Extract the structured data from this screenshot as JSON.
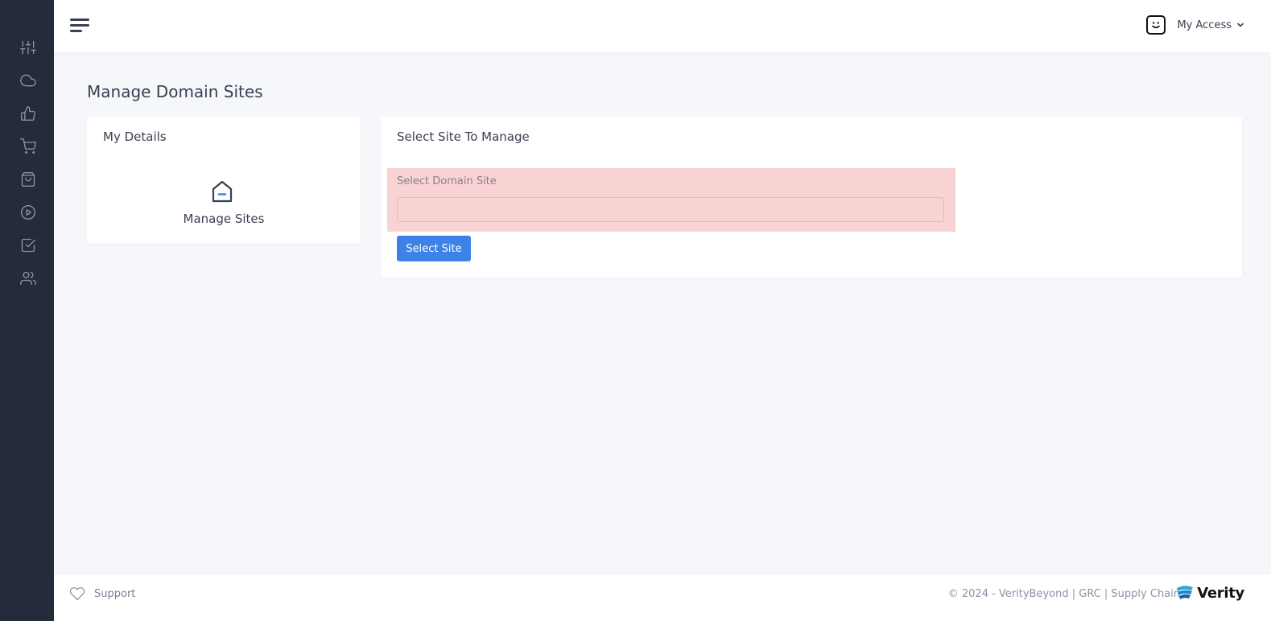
{
  "sidebar": {
    "items": [
      {
        "icon": "sliders-icon"
      },
      {
        "icon": "cloud-icon"
      },
      {
        "icon": "thumbs-up-icon"
      },
      {
        "icon": "shopping-cart-icon"
      },
      {
        "icon": "shopping-bag-icon"
      },
      {
        "icon": "play-circle-icon"
      },
      {
        "icon": "check-square-icon"
      },
      {
        "icon": "users-icon"
      }
    ]
  },
  "header": {
    "menu_icon": "hamburger-icon",
    "account_label": "My Access",
    "account_icon": "smiley-icon"
  },
  "page": {
    "title": "Manage Domain Sites"
  },
  "details_card": {
    "title": "My Details",
    "link_label": "Manage Sites",
    "link_icon": "house-icon"
  },
  "select_card": {
    "title": "Select Site To Manage",
    "field_label": "Select Domain Site",
    "field_value": "",
    "button_label": "Select Site"
  },
  "footer": {
    "support_label": "Support",
    "copyright": "© 2024 - VerityBeyond | GRC | Supply Chain",
    "logo_text": "Verity"
  },
  "colors": {
    "sidebar_bg": "#262b3c",
    "accent": "#3d82e7",
    "error_bg": "#f9d3d3"
  }
}
